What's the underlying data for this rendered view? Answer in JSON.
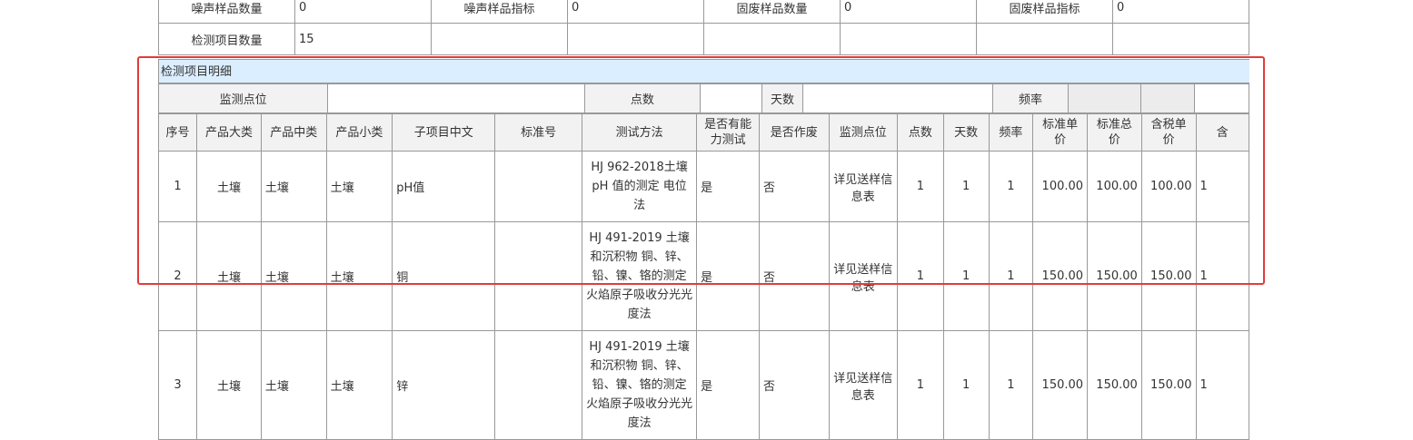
{
  "summary": {
    "row1": [
      "噪声样品数量",
      "0",
      "噪声样品指标",
      "0",
      "固废样品数量",
      "0",
      "固废样品指标",
      "0"
    ],
    "row2": [
      "检测项目数量",
      "15",
      "",
      "",
      "",
      "",
      "",
      ""
    ]
  },
  "section": {
    "title": "检测项目明细"
  },
  "filter": {
    "point_label": "监测点位",
    "point_value": "",
    "count_label": "点数",
    "count_value": "",
    "days_label": "天数",
    "days_value": "",
    "freq_label": "频率",
    "freq_value": ""
  },
  "columns": [
    "序号",
    "产品大类",
    "产品中类",
    "产品小类",
    "子项目中文",
    "标准号",
    "测试方法",
    "是否有能力测试",
    "是否作废",
    "监测点位",
    "点数",
    "天数",
    "频率",
    "标准单价",
    "标准总价",
    "含税单价",
    "含"
  ],
  "rows": [
    {
      "no": "1",
      "cat1": "土壤",
      "cat2": "土壤",
      "cat3": "土壤",
      "item": "pH值",
      "std": "",
      "method": "HJ 962-2018土壤pH 值的测定 电位法",
      "capable": "是",
      "void": "否",
      "point": "详见送样信息表",
      "points": "1",
      "days": "1",
      "freq": "1",
      "unit_price": "100.00",
      "total_price": "100.00",
      "tax_price": "100.00",
      "more": "1"
    },
    {
      "no": "2",
      "cat1": "土壤",
      "cat2": "土壤",
      "cat3": "土壤",
      "item": "铜",
      "std": "",
      "method": "HJ 491-2019 土壤和沉积物 铜、锌、铅、镍、铬的测定 火焰原子吸收分光光度法",
      "capable": "是",
      "void": "否",
      "point": "详见送样信息表",
      "points": "1",
      "days": "1",
      "freq": "1",
      "unit_price": "150.00",
      "total_price": "150.00",
      "tax_price": "150.00",
      "more": "1"
    },
    {
      "no": "3",
      "cat1": "土壤",
      "cat2": "土壤",
      "cat3": "土壤",
      "item": "锌",
      "std": "",
      "method": "HJ 491-2019 土壤和沉积物 铜、锌、铅、镍、铬的测定 火焰原子吸收分光光度法",
      "capable": "是",
      "void": "否",
      "point": "详见送样信息表",
      "points": "1",
      "days": "1",
      "freq": "1",
      "unit_price": "150.00",
      "total_price": "150.00",
      "tax_price": "150.00",
      "more": "1"
    }
  ],
  "highlight_color": "#e23b3b"
}
